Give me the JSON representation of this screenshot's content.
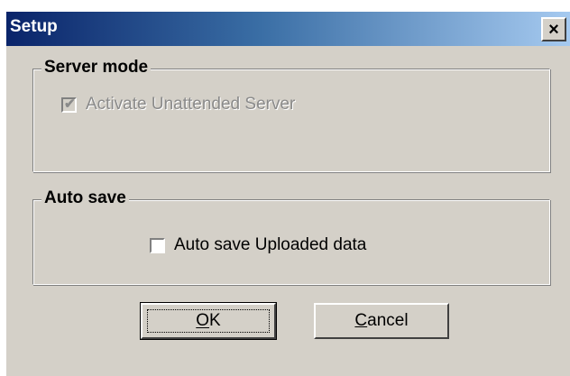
{
  "window": {
    "title": "Setup"
  },
  "titlebar": {
    "close_glyph": "×",
    "close_icon": "close-icon"
  },
  "server_mode": {
    "legend": "Server mode",
    "checkbox_label": "Activate Unattended Server",
    "checked": true,
    "enabled": false
  },
  "auto_save": {
    "legend": "Auto save",
    "checkbox_label": "Auto save Uploaded data",
    "checked": false,
    "enabled": true
  },
  "buttons": {
    "ok_label": "OK",
    "cancel_label": "Cancel"
  },
  "colors": {
    "titlebar_start": "#0a246a",
    "titlebar_end": "#a6caf0",
    "face": "#d4d0c8",
    "disabled_text": "#8a8a8a"
  }
}
